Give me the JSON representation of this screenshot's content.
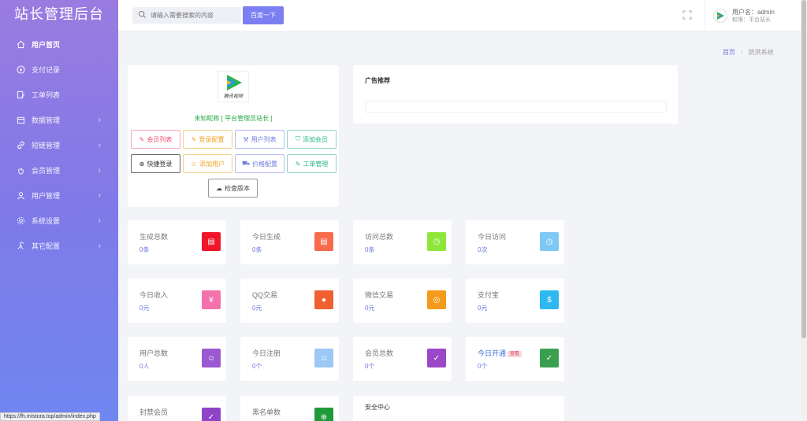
{
  "brand": "站长管理后台",
  "sidebar": {
    "items": [
      {
        "label": "用户首页",
        "icon": "home-icon",
        "active": true
      },
      {
        "label": "支付记录",
        "icon": "yen-circle-icon"
      },
      {
        "label": "工单列表",
        "icon": "ticket-edit-icon"
      },
      {
        "label": "数据管理",
        "icon": "calendar-icon",
        "has_children": true
      },
      {
        "label": "短链管理",
        "icon": "link-icon",
        "has_children": true
      },
      {
        "label": "会员管理",
        "icon": "hand-icon",
        "has_children": true
      },
      {
        "label": "用户管理",
        "icon": "user-icon",
        "has_children": true
      },
      {
        "label": "系统设置",
        "icon": "gear-icon",
        "has_children": true
      },
      {
        "label": "其它配置",
        "icon": "tools-icon",
        "has_children": true
      }
    ]
  },
  "header": {
    "search_placeholder": "请输入需要搜索的内容",
    "search_button": "百度一下",
    "user_name": "用户名：admin",
    "user_role": "权限：平台站长"
  },
  "breadcrumb": {
    "home": "首页",
    "current": "防洪系统"
  },
  "profile": {
    "logo_caption": "腾讯视频",
    "nickname": "未知昵称 [ 平台管理员站长 ]",
    "buttons": [
      {
        "label": "会员列表",
        "icon": "edit-icon",
        "color": "red"
      },
      {
        "label": "登录配置",
        "icon": "edit-icon",
        "color": "yellow"
      },
      {
        "label": "用户列表",
        "icon": "tools-icon",
        "color": "blue"
      },
      {
        "label": "添加会员",
        "icon": "shield-icon",
        "color": "green"
      },
      {
        "label": "快捷登录",
        "icon": "plus-circle-icon",
        "color": "dark"
      },
      {
        "label": "添加用户",
        "icon": "user-icon",
        "color": "yellow"
      },
      {
        "label": "价格配置",
        "icon": "cart-icon",
        "color": "blue"
      },
      {
        "label": "工单管理",
        "icon": "ticket-edit-icon",
        "color": "green"
      }
    ],
    "check_version": "检查版本"
  },
  "ad": {
    "title": "广告推荐"
  },
  "stats": [
    {
      "label": "生成总数",
      "value": "0条",
      "color": "#f0162a",
      "icon": "file-icon"
    },
    {
      "label": "今日生成",
      "value": "0条",
      "color": "#f76b4b",
      "icon": "file-icon"
    },
    {
      "label": "访问总数",
      "value": "0条",
      "color": "#8fe63b",
      "icon": "clock-icon"
    },
    {
      "label": "今日访问",
      "value": "0次",
      "color": "#7ec8f6",
      "icon": "clock-icon"
    },
    {
      "label": "今日收入",
      "value": "0元",
      "color": "#f472ac",
      "icon": "yen-circle-icon"
    },
    {
      "label": "QQ交易",
      "value": "0元",
      "color": "#f06030",
      "icon": "qq-icon"
    },
    {
      "label": "微信交易",
      "value": "0元",
      "color": "#f59a1a",
      "icon": "wechat-icon"
    },
    {
      "label": "支付宝",
      "value": "0元",
      "color": "#2eb8f0",
      "icon": "alipay-icon"
    },
    {
      "label": "用户总数",
      "value": "0人",
      "color": "#9b58d0",
      "icon": "users-icon"
    },
    {
      "label": "今日注册",
      "value": "0个",
      "color": "#9bc8f5",
      "icon": "users-icon"
    },
    {
      "label": "会员总数",
      "value": "0个",
      "color": "#9b47c8",
      "icon": "shield-icon"
    },
    {
      "label": "今日开通",
      "value": "0个",
      "color": "#3aa050",
      "icon": "shield-icon",
      "badge": "查看"
    },
    {
      "label": "封禁会员",
      "value": "",
      "color": "#8e44c8",
      "icon": "shield-icon"
    },
    {
      "label": "黑名单数",
      "value": "",
      "color": "#1f9a3a",
      "icon": "globe-icon"
    }
  ],
  "security": {
    "title": "安全中心"
  },
  "status_url": "https://fh.mistora.top/admin/index.php"
}
